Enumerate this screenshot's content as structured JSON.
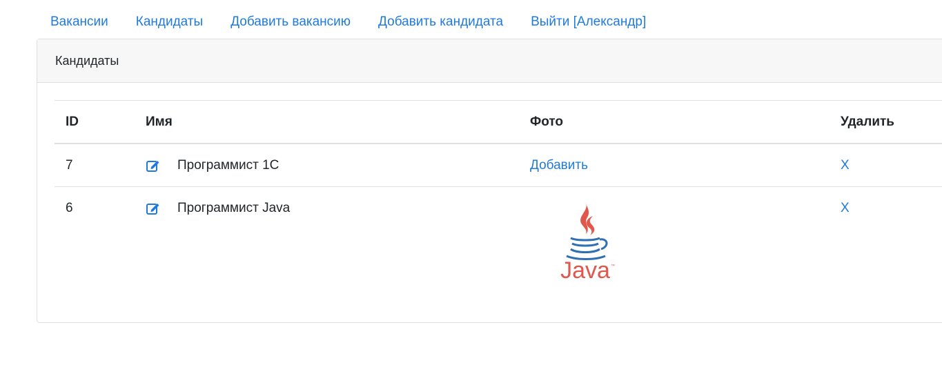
{
  "nav": {
    "items": [
      {
        "label": "Вакансии"
      },
      {
        "label": "Кандидаты"
      },
      {
        "label": "Добавить вакансию"
      },
      {
        "label": "Добавить кандидата"
      },
      {
        "label": "Выйти [Александр]"
      }
    ]
  },
  "card": {
    "title": "Кандидаты"
  },
  "table": {
    "headers": {
      "id": "ID",
      "name": "Имя",
      "photo": "Фото",
      "delete": "Удалить"
    },
    "rows": [
      {
        "id": "7",
        "name": "Программист 1С",
        "photo_link": "Добавить",
        "delete": "X"
      },
      {
        "id": "6",
        "name": "Программист Java",
        "photo_alt": "Java",
        "delete": "X"
      }
    ]
  },
  "colors": {
    "link": "#1f7ae0",
    "border": "#dfdfdf",
    "header_bg": "#f7f7f7",
    "java_red": "#e2574c",
    "java_blue": "#2f6fb3"
  },
  "icons": {
    "edit": "edit-icon",
    "java_logo": "java-logo"
  }
}
